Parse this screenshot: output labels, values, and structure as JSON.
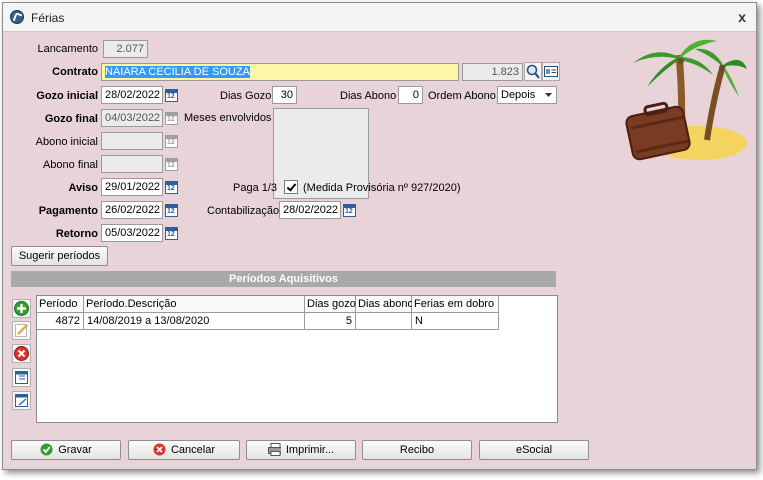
{
  "window": {
    "title": "Férias",
    "close": "x"
  },
  "form": {
    "lancamento_label": "Lancamento",
    "lancamento_value": "2.077",
    "contrato_label": "Contrato",
    "contrato_value": "NAIARA CECILIA DE SOUZA",
    "contrato_code": "1.823",
    "gozo_inicial_label": "Gozo inicial",
    "gozo_inicial_value": "28/02/2022",
    "gozo_final_label": "Gozo final",
    "gozo_final_value": "04/03/2022",
    "abono_inicial_label": "Abono inicial",
    "abono_inicial_value": "",
    "abono_final_label": "Abono final",
    "abono_final_value": "",
    "aviso_label": "Aviso",
    "aviso_value": "29/01/2022",
    "pagamento_label": "Pagamento",
    "pagamento_value": "26/02/2022",
    "retorno_label": "Retorno",
    "retorno_value": "05/03/2022",
    "dias_gozo_label": "Dias Gozo",
    "dias_gozo_value": "30",
    "dias_abono_label": "Dias Abono",
    "dias_abono_value": "0",
    "ordem_abono_label": "Ordem Abono",
    "ordem_abono_value": "Depois",
    "meses_label": "Meses envolvidos",
    "paga_label": "Paga 1/3",
    "paga_note": "(Medida Provisória nº 927/2020)",
    "paga_checked": true,
    "contabilizacao_label": "Contabilização",
    "contabilizacao_value": "28/02/2022",
    "calendar_glyph": "12"
  },
  "sugerir_button": "Sugerir períodos",
  "periodos": {
    "title": "Períodos Aquisitivos",
    "columns": [
      "Período",
      "Período.Descrição",
      "Dias gozo",
      "Dias abono",
      "Ferias em dobro"
    ],
    "rows": [
      [
        "4872",
        "14/08/2019 a 13/08/2020",
        "5",
        "",
        "N"
      ]
    ]
  },
  "buttons": {
    "gravar": "Gravar",
    "cancelar": "Cancelar",
    "imprimir": "Imprimir...",
    "recibo": "Recibo",
    "esocial": "eSocial"
  },
  "colors": {
    "window_bg": "#e8d3d8",
    "contrato_bg": "#fcf6a7",
    "selection": "#3399ff",
    "section_header": "#a9a9a9"
  },
  "icons": [
    "app-icon",
    "search-icon",
    "card-icon",
    "calendar-icon",
    "add-icon",
    "edit-icon",
    "delete-icon",
    "grid-icon",
    "check-icon",
    "cancel-icon",
    "printer-icon",
    "palm-suitcase-illustration"
  ]
}
